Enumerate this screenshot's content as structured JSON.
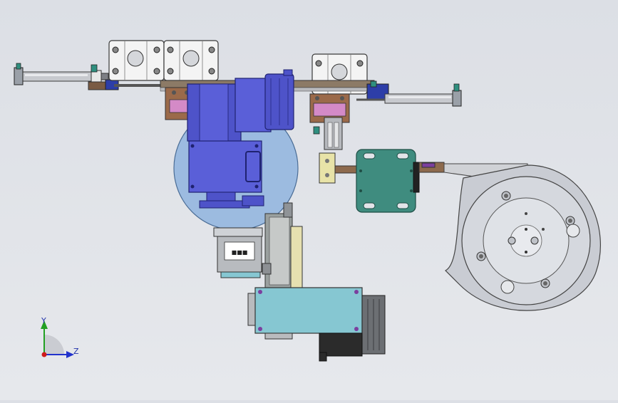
{
  "triad": {
    "y_label": "Y",
    "z_label": "Z"
  },
  "colors": {
    "background": "#e2e4e9",
    "blue_motor": "#5a5fd8",
    "transparent_blue": "#8fb4de",
    "teal_plate": "#3f8c7f",
    "cyan_block": "#86c7d2",
    "white_block": "#f4f4f4",
    "grey_disc": "#c9ccd3",
    "bronze_bracket": "#9b6a4a",
    "pink_part": "#d48ac7",
    "dark_motor": "#2b2b2b"
  }
}
